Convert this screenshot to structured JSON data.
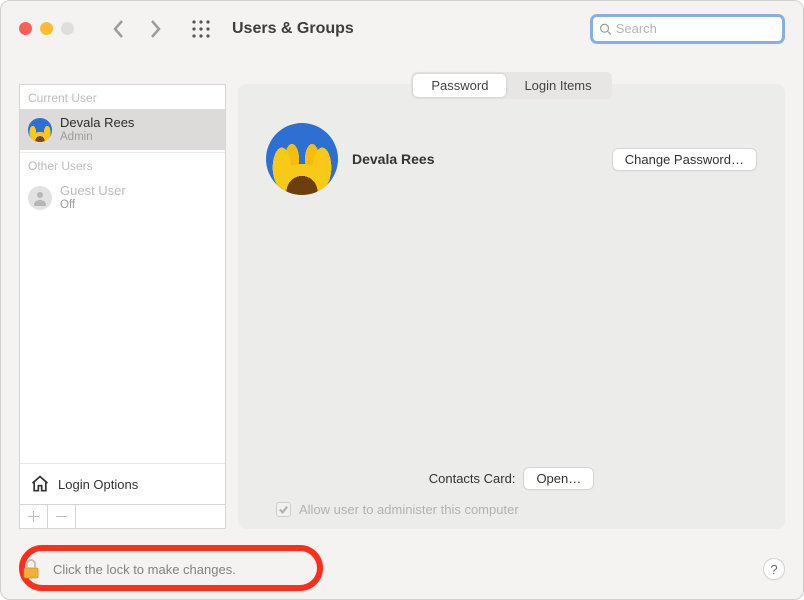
{
  "window": {
    "title": "Users & Groups"
  },
  "search": {
    "placeholder": "Search"
  },
  "sidebar": {
    "section_current": "Current User",
    "section_other": "Other Users",
    "current": {
      "name": "Devala Rees",
      "role": "Admin"
    },
    "guest": {
      "name": "Guest User",
      "status": "Off"
    },
    "login_options": "Login Options"
  },
  "tabs": {
    "password": "Password",
    "login_items": "Login Items"
  },
  "profile": {
    "name": "Devala Rees",
    "change_password": "Change Password…"
  },
  "contacts": {
    "label": "Contacts Card:",
    "open": "Open…"
  },
  "admin_checkbox": "Allow user to administer this computer",
  "footer": {
    "lock_text": "Click the lock to make changes."
  },
  "help": "?"
}
